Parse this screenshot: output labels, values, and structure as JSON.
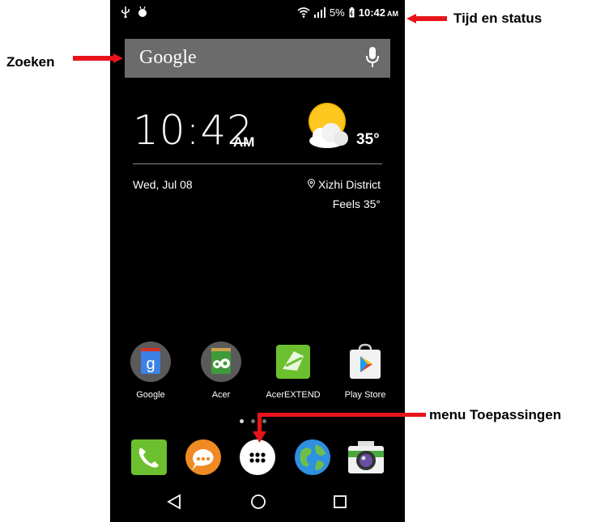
{
  "status_bar": {
    "battery": "5%",
    "time": "10:42",
    "ampm": "AM",
    "icons": [
      "usb-icon",
      "android-debug-icon",
      "wifi-icon",
      "signal-icon",
      "battery-icon"
    ]
  },
  "search": {
    "logo": "Google",
    "icon": "mic-icon"
  },
  "clock_widget": {
    "time": "10:42",
    "ampm": "AM",
    "temperature": "35°",
    "date": "Wed, Jul 08",
    "location": "Xizhi District",
    "feels": "Feels 35°",
    "weather_icon": "sun-cloud-icon"
  },
  "apps": [
    {
      "label": "Google"
    },
    {
      "label": "Acer"
    },
    {
      "label": "AcerEXTEND"
    },
    {
      "label": "Play Store"
    }
  ],
  "dock": [
    "phone-icon",
    "messages-icon",
    "app-drawer-icon",
    "browser-icon",
    "camera-icon"
  ],
  "nav": [
    "back-icon",
    "home-icon",
    "recents-icon"
  ],
  "annotations": {
    "status": "Tijd en status",
    "search": "Zoeken",
    "apps_menu": "menu Toepassingen"
  },
  "colors": {
    "arrow": "#e8141b",
    "screen": "#000000"
  }
}
